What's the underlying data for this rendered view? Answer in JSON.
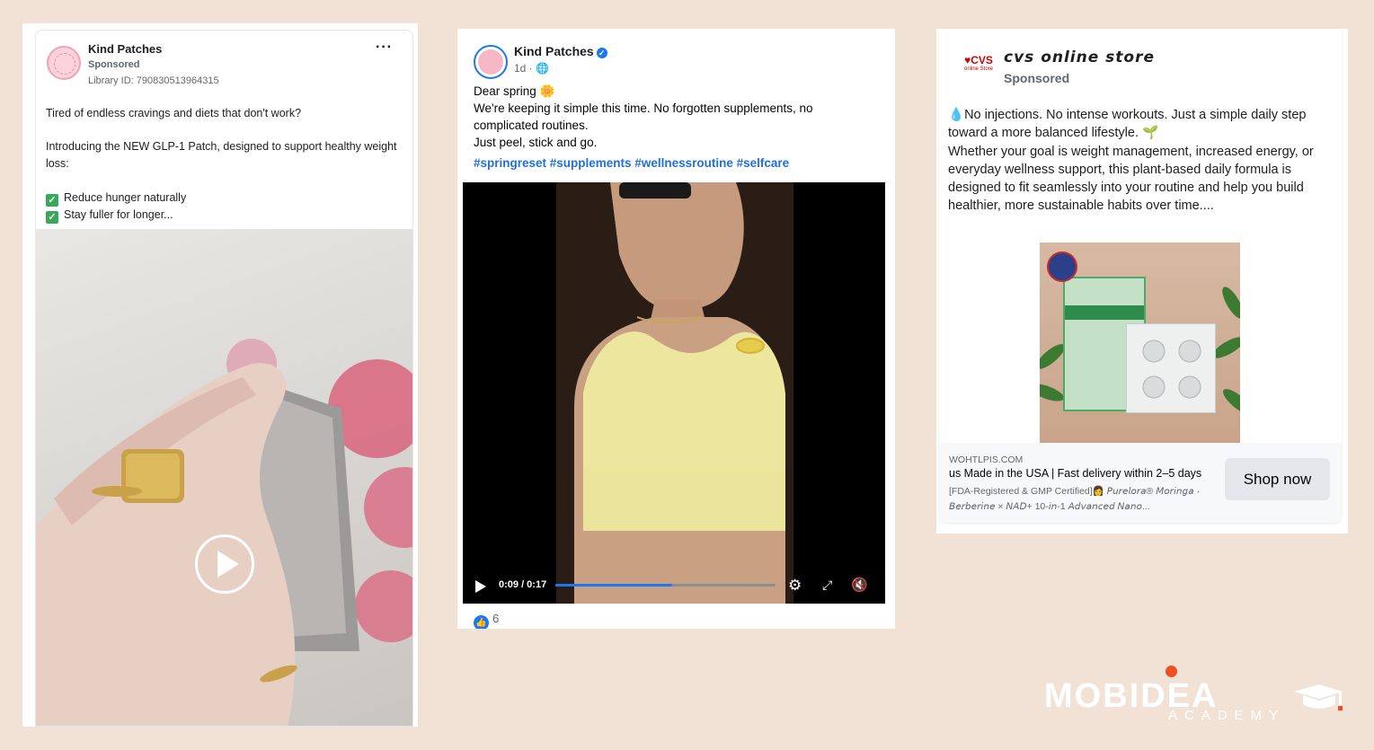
{
  "card1": {
    "page_name": "Kind Patches",
    "sponsored": "Sponsored",
    "library_id": "Library ID: 790830513964315",
    "more": "···",
    "line1": "Tired of endless cravings and diets that don't work?",
    "line2": "Introducing the NEW GLP-1 Patch, designed to support healthy weight loss:",
    "bullet1": "Reduce hunger naturally",
    "bullet2": "Stay fuller for longer..."
  },
  "card2": {
    "page_name": "Kind Patches",
    "time": "1d · ",
    "line1": "Dear spring",
    "line2": "We're keeping it simple this time. No forgotten supplements, no complicated routines.",
    "line3": "Just peel, stick and go.",
    "hashtags": "#springreset #supplements #wellnessroutine #selfcare",
    "video_time": "0:09 / 0:17",
    "progress": 0.53,
    "likes": "6"
  },
  "card3": {
    "logo_text": "♥CVS",
    "logo_sub": "online Store",
    "page_name": "cvs online store",
    "sponsored": "Sponsored",
    "body_line1": "No injections. No intense workouts. Just a simple daily step toward a more balanced lifestyle.",
    "body_line2": "Whether your goal is weight management, increased energy, or everyday wellness support, this plant-based daily formula is designed to fit seamlessly into your routine and help you build healthier, more sustainable habits over time....",
    "domain": "WOHTLPIS.COM",
    "headline": "us Made in the USA | Fast delivery within 2–5 days",
    "description": "[FDA-Registered & GMP Certified]👩 𝘗𝘶𝘳𝘦𝘭𝘰𝘳𝘢® 𝘔𝘰𝘳𝘪𝘯𝘨𝘢 · 𝘉𝘦𝘳𝘣𝘦𝘳𝘪𝘯𝘦 × 𝘕𝘈𝘋+ 10-𝘪𝘯-1 𝘈𝘥𝘷𝘢𝘯𝘤𝘦𝘥 𝘕𝘢𝘯𝘰...",
    "cta": "Shop now"
  },
  "logo": {
    "word": "MOBIDEA",
    "sub": "ACADEMY"
  }
}
